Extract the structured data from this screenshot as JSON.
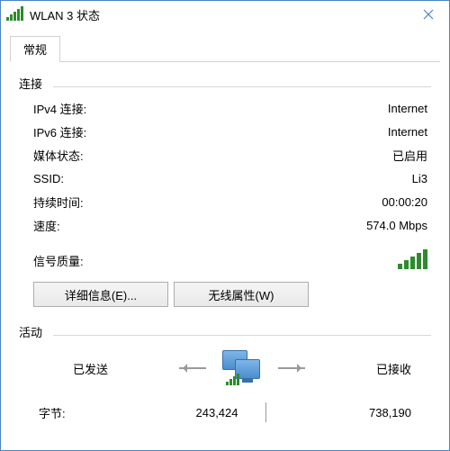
{
  "window": {
    "title": "WLAN 3 状态"
  },
  "tabs": {
    "general": "常规"
  },
  "connection": {
    "section_label": "连接",
    "rows": {
      "ipv4_label": "IPv4 连接:",
      "ipv4_value": "Internet",
      "ipv6_label": "IPv6 连接:",
      "ipv6_value": "Internet",
      "media_label": "媒体状态:",
      "media_value": "已启用",
      "ssid_label": "SSID:",
      "ssid_value": "Li3",
      "duration_label": "持续时间:",
      "duration_value": "00:00:20",
      "speed_label": "速度:",
      "speed_value": "574.0 Mbps",
      "signal_label": "信号质量:"
    },
    "buttons": {
      "details": "详细信息(E)...",
      "wireless": "无线属性(W)"
    }
  },
  "activity": {
    "section_label": "活动",
    "sent_label": "已发送",
    "received_label": "已接收",
    "bytes_label": "字节:",
    "bytes_sent": "243,424",
    "bytes_received": "738,190"
  }
}
